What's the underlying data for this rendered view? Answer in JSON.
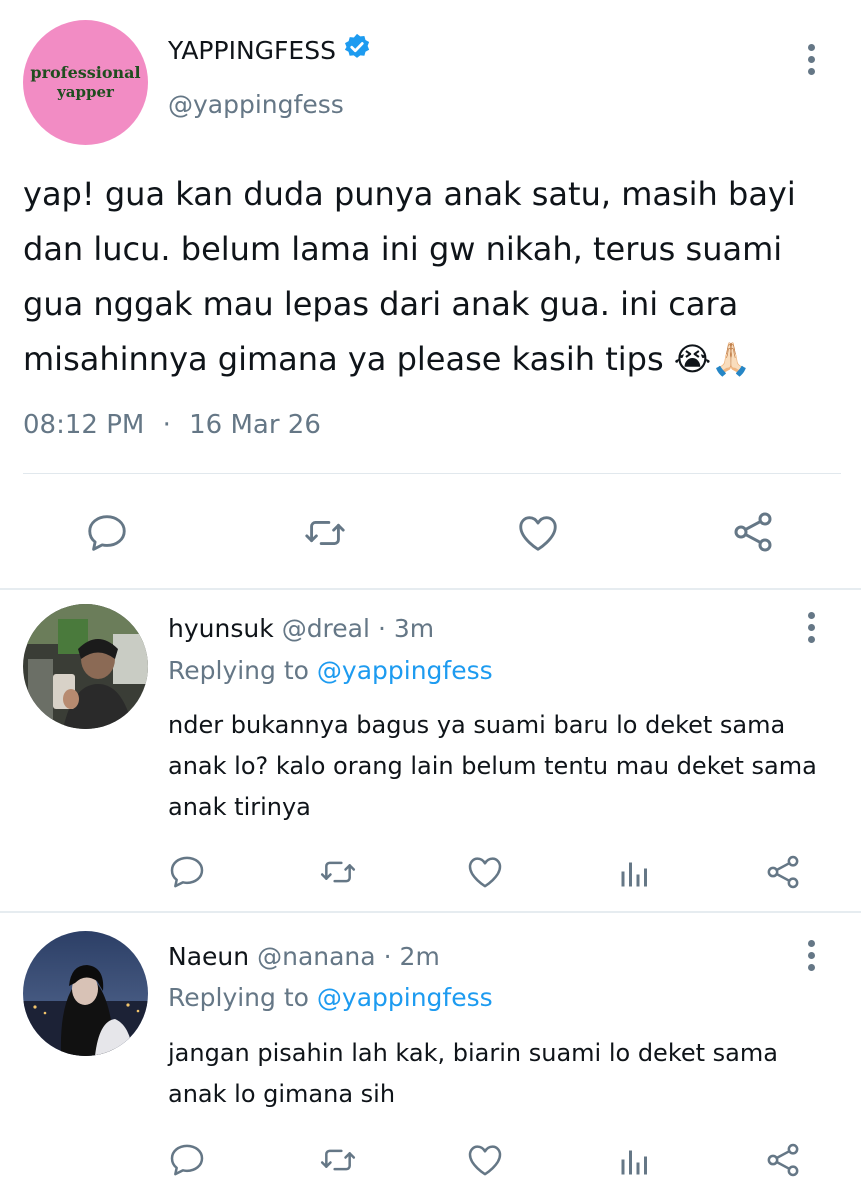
{
  "tweet": {
    "avatar_text_line1": "professional",
    "avatar_text_line2": "yapper",
    "display_name": "YAPPINGFESS",
    "handle": "@yappingfess",
    "text": "yap! gua kan duda punya anak satu, masih bayi dan lucu. belum lama ini gw nikah, terus suami gua nggak mau lepas dari anak gua. ini cara misahinnya gimana ya please kasih tips 😭🙏🏻",
    "time": "08:12 PM",
    "separator": "·",
    "date": "16 Mar 26",
    "actions": [
      "comment-icon",
      "retweet-icon",
      "like-icon",
      "share-icon"
    ]
  },
  "replies": [
    {
      "name": "hyunsuk",
      "handle": "@dreal",
      "separator": "·",
      "age": "3m",
      "replying_prefix": "Replying to",
      "replying_to": "@yappingfess",
      "text": "nder bukannya bagus ya suami baru lo deket sama anak lo? kalo orang lain belum tentu mau deket sama anak tirinya"
    },
    {
      "name": "Naeun",
      "handle": "@nanana",
      "separator": "·",
      "age": "2m",
      "replying_prefix": "Replying to",
      "replying_to": "@yappingfess",
      "text": "jangan pisahin lah kak, biarin suami lo deket sama anak lo gimana sih"
    }
  ],
  "colors": {
    "accent": "#1d9bf0",
    "avatar_bg": "#f28cc4",
    "text": "#0f1419",
    "muted": "#657786"
  }
}
